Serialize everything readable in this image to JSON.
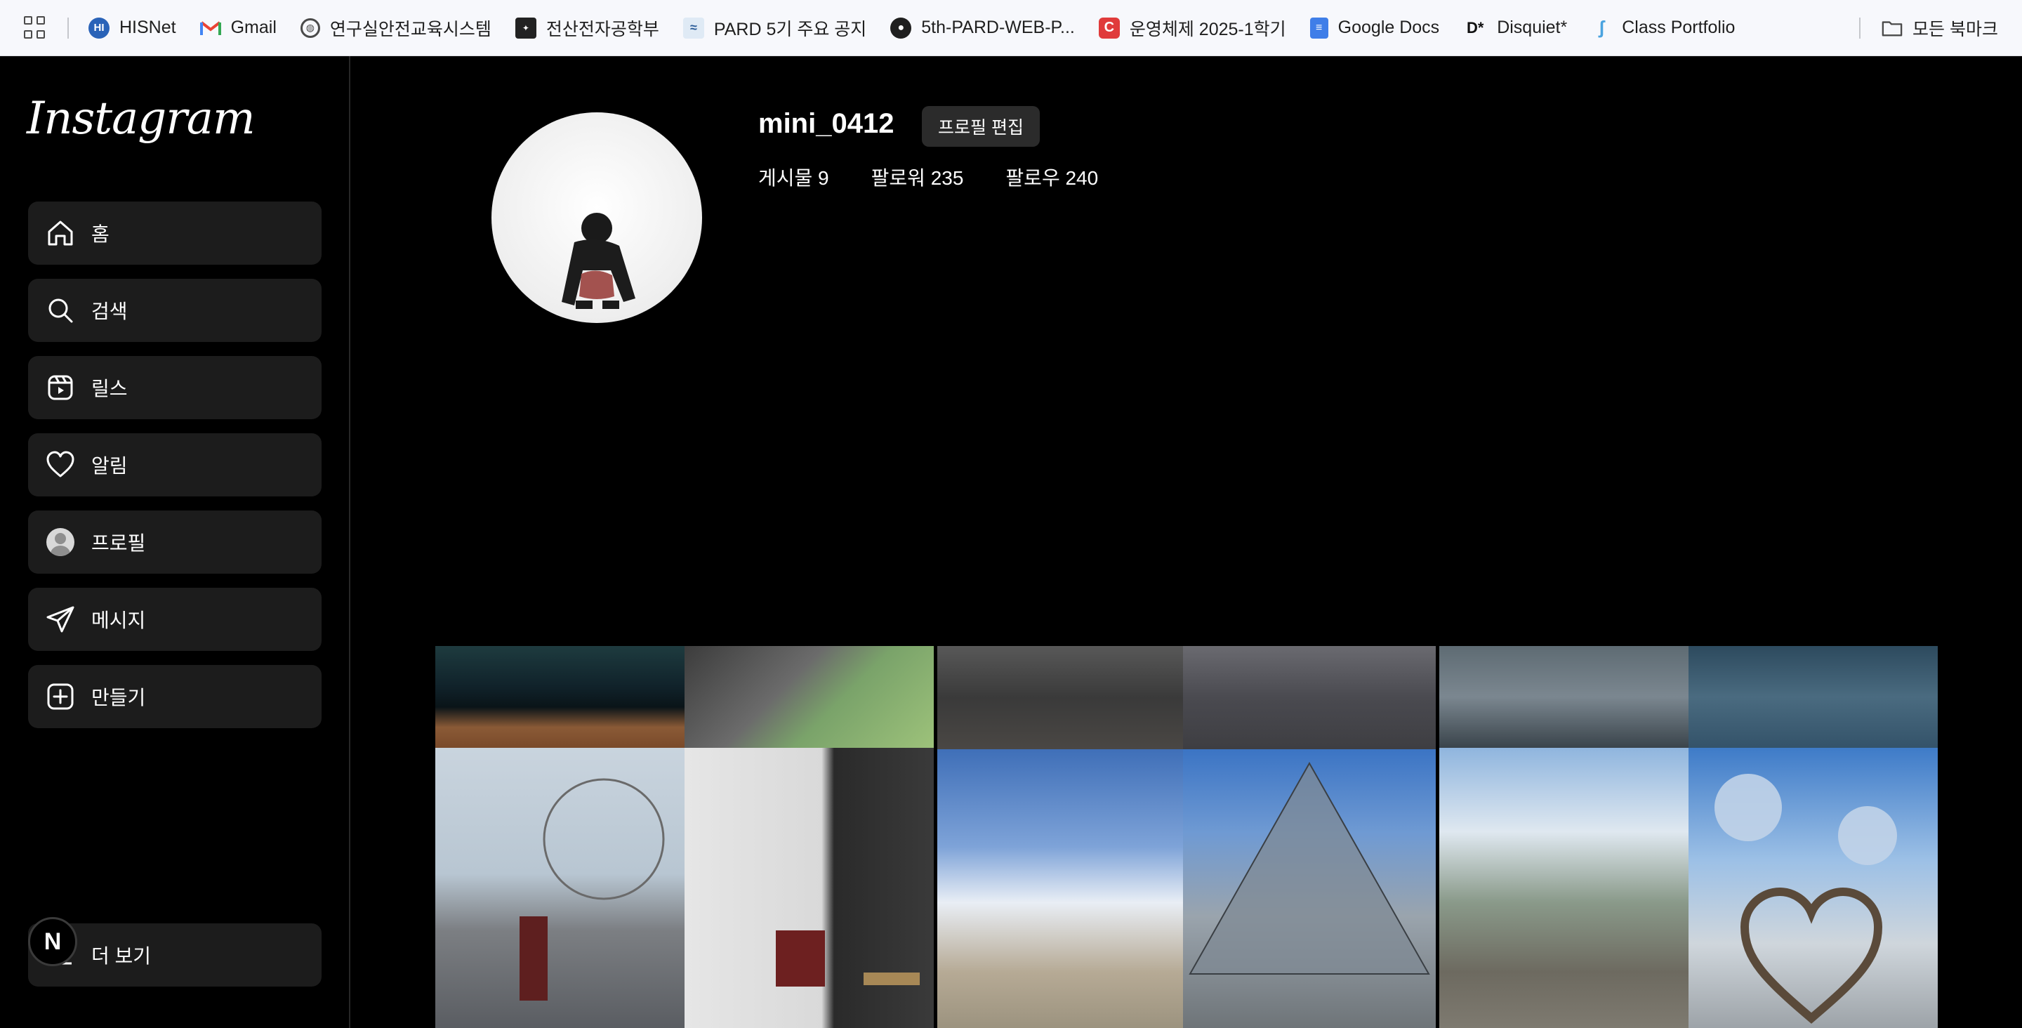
{
  "bookmarks": {
    "items": [
      {
        "label": "HISNet",
        "icon": "hisnet-icon"
      },
      {
        "label": "Gmail",
        "icon": "gmail-icon"
      },
      {
        "label": "연구실안전교육시스템",
        "icon": "globe-icon"
      },
      {
        "label": "전산전자공학부",
        "icon": "dept-icon"
      },
      {
        "label": "PARD 5기 주요 공지",
        "icon": "wave-icon"
      },
      {
        "label": "5th-PARD-WEB-P...",
        "icon": "github-icon"
      },
      {
        "label": "운영체제 2025-1학기",
        "icon": "c-icon"
      },
      {
        "label": "Google Docs",
        "icon": "docs-icon"
      },
      {
        "label": "Disquiet*",
        "icon": "disquiet-icon"
      },
      {
        "label": "Class Portfolio",
        "icon": "portfolio-icon"
      }
    ],
    "all_bookmarks": "모든 북마크"
  },
  "sidebar": {
    "logo": "Instagram",
    "items": [
      {
        "label": "홈",
        "icon": "home-icon"
      },
      {
        "label": "검색",
        "icon": "search-icon"
      },
      {
        "label": "릴스",
        "icon": "reels-icon"
      },
      {
        "label": "알림",
        "icon": "heart-icon"
      },
      {
        "label": "프로필",
        "icon": "avatar-icon"
      },
      {
        "label": "메시지",
        "icon": "send-icon"
      },
      {
        "label": "만들기",
        "icon": "plus-square-icon"
      }
    ],
    "more": "더 보기",
    "badge": "N"
  },
  "profile": {
    "username": "mini_0412",
    "edit_button": "프로필 편집",
    "stats": {
      "posts": "게시물 9",
      "followers": "팔로워 235",
      "following": "팔로우 240"
    }
  },
  "colors": {
    "background": "#000000",
    "nav_item": "#1c1c1c",
    "button": "#2b2b2b",
    "bookmarks_bar": "#f7f8fc"
  }
}
